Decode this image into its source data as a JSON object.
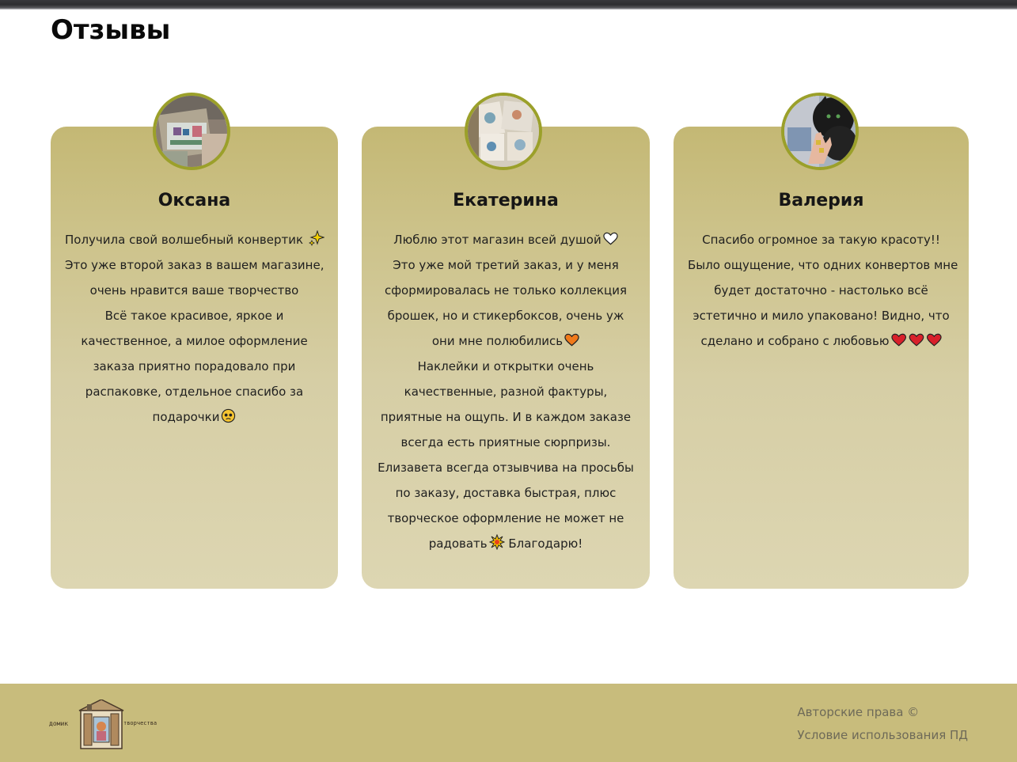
{
  "page": {
    "title": "Отзывы"
  },
  "reviews": [
    {
      "name": "Оксана",
      "avatar_icon": "customer-photo-envelope",
      "lines": [
        {
          "text": "Получила свой волшебный конвертик",
          "emoji": "sparkles-emoji"
        },
        {
          "text": "Это уже второй заказ в вашем магазине,"
        },
        {
          "text": "очень нравится ваше творчество"
        },
        {
          "text": "Всё такое красивое, яркое и"
        },
        {
          "text": "качественное, а милое оформление"
        },
        {
          "text": "заказа приятно порадовало при"
        },
        {
          "text": "распаковке, отдельное спасибо за"
        },
        {
          "text": "подарочки",
          "emoji": "pleading-face-emoji"
        }
      ]
    },
    {
      "name": "Екатерина",
      "avatar_icon": "customer-photo-stickers",
      "lines": [
        {
          "text": "Люблю этот магазин всей душой",
          "emoji": "white-heart-emoji"
        },
        {
          "text": "Это уже мой третий заказ, и у меня"
        },
        {
          "text": "сформировалась не только коллекция"
        },
        {
          "text": "брошек, но и стикербоксов, очень уж"
        },
        {
          "text": "они мне полюбились",
          "emoji": "orange-heart-emoji"
        },
        {
          "text": "Наклейки и открытки очень"
        },
        {
          "text": "качественные, разной фактуры,"
        },
        {
          "text": "приятные на ощупь. И в каждом заказе"
        },
        {
          "text": "всегда есть приятные сюрпризы."
        },
        {
          "text": "Елизавета всегда отзывчива на просьбы"
        },
        {
          "text": "по заказу, доставка быстрая, плюс"
        },
        {
          "text": "творческое оформление не может не"
        },
        {
          "text": "радовать",
          "emoji": "collision-emoji",
          "after": " Благодарю!"
        }
      ]
    },
    {
      "name": "Валерия",
      "avatar_icon": "customer-photo-cat",
      "lines": [
        {
          "text": "Спасибо огромное за такую красоту!!"
        },
        {
          "text": "Было ощущение, что одних конвертов мне"
        },
        {
          "text": "будет достаточно - настолько всё"
        },
        {
          "text": "эстетично и мило упаковано! Видно, что"
        },
        {
          "text": "сделано и собрано с любовью",
          "emoji": "three-red-hearts-emoji"
        }
      ]
    }
  ],
  "footer": {
    "logo_left_text": "домик",
    "logo_right_text": "творчества",
    "links": [
      "Авторские права ©",
      "Условие использования ПД"
    ]
  },
  "colors": {
    "card_top": "#c4b874",
    "card_bottom": "#ddd6b2",
    "avatar_border": "#9ba02a",
    "footer_bg": "#c8bc7c",
    "footer_text": "#6e6a58"
  }
}
